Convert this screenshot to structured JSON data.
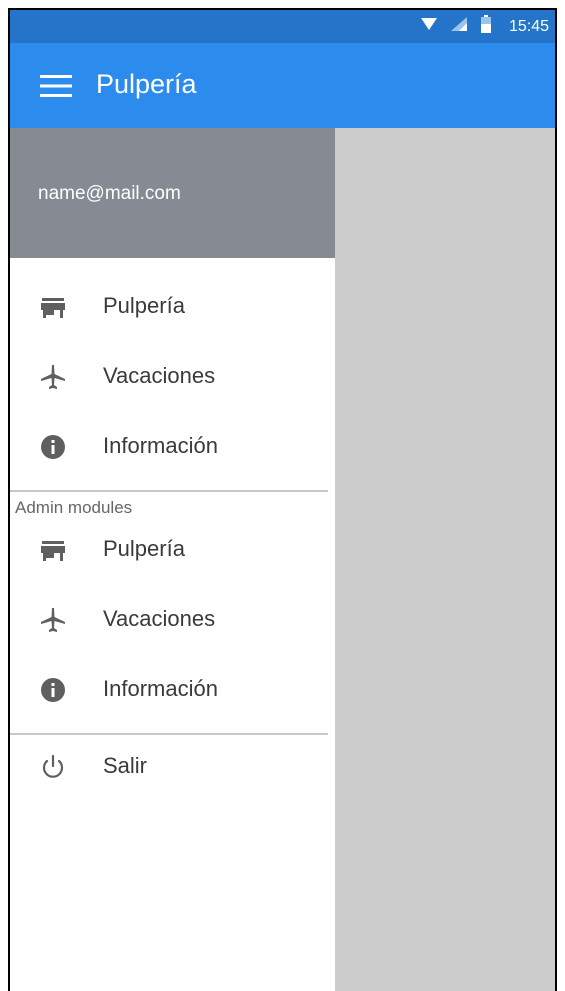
{
  "status_bar": {
    "time": "15:45",
    "icons": [
      "wifi-icon",
      "signal-icon",
      "battery-icon"
    ]
  },
  "app_bar": {
    "title": "Pulpería",
    "menu_icon": "hamburger-menu-icon"
  },
  "drawer": {
    "email": "name@mail.com",
    "main_items": [
      {
        "label": "Pulpería",
        "icon": "store-icon"
      },
      {
        "label": "Vacaciones",
        "icon": "airplane-icon"
      },
      {
        "label": "Información",
        "icon": "info-icon"
      }
    ],
    "admin_section_label": "Admin modules",
    "admin_items": [
      {
        "label": "Pulpería",
        "icon": "store-icon"
      },
      {
        "label": "Vacaciones",
        "icon": "airplane-icon"
      },
      {
        "label": "Información",
        "icon": "info-icon"
      }
    ],
    "logout": {
      "label": "Salir",
      "icon": "power-icon"
    }
  },
  "colors": {
    "status_bar": "#2475c9",
    "app_bar": "#2b8cee",
    "drawer_header": "#868b93",
    "scrim": "#cccccc",
    "icon": "#5f5f5f"
  }
}
